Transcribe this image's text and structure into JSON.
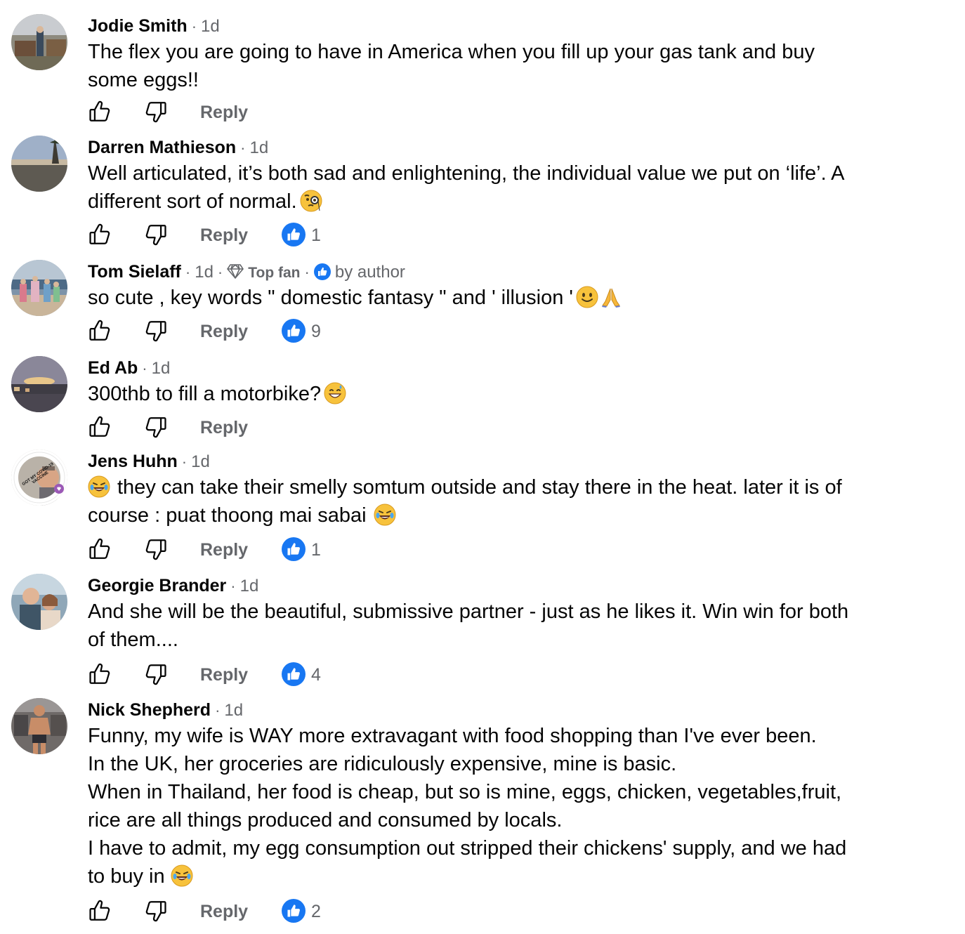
{
  "comments": [
    {
      "author": "Jodie Smith",
      "time": "1d",
      "lines": [
        "The flex you are going to have in America when you fill up your gas tank and buy",
        "some eggs!!"
      ],
      "reply_label": "Reply",
      "reaction_count": ""
    },
    {
      "author": "Darren Mathieson",
      "time": "1d",
      "lines": [
        "Well articulated, it’s both sad and enlightening, the individual value we put on ‘life’. A",
        "different sort of normal."
      ],
      "reply_label": "Reply",
      "reaction_count": "1"
    },
    {
      "author": "Tom Sielaff",
      "time": "1d",
      "badge": "Top fan",
      "author_tag": "by author",
      "lines": [
        "so cute , key words \" domestic fantasy \" and ' illusion '"
      ],
      "reply_label": "Reply",
      "reaction_count": "9"
    },
    {
      "author": "Ed Ab",
      "time": "1d",
      "lines": [
        "300thb to fill a motorbike?"
      ],
      "reply_label": "Reply",
      "reaction_count": ""
    },
    {
      "author": "Jens Huhn",
      "time": "1d",
      "lines": [
        "they can take their smelly somtum outside and stay there in the heat. later it is of",
        "course : puat thoong mai sabai"
      ],
      "reply_label": "Reply",
      "reaction_count": "1"
    },
    {
      "author": "Georgie Brander",
      "time": "1d",
      "lines": [
        "And she will be the beautiful, submissive partner - just as he likes it. Win win for both",
        "of them...."
      ],
      "reply_label": "Reply",
      "reaction_count": "4"
    },
    {
      "author": "Nick Shepherd",
      "time": "1d",
      "lines": [
        "Funny, my wife is WAY more extravagant with food shopping than I've ever been.",
        "In the UK, her groceries are ridiculously expensive, mine is basic.",
        "When in Thailand, her food is cheap, but so is mine, eggs, chicken, vegetables,fruit,",
        "rice are all things produced and consumed by locals.",
        "I have to admit, my egg consumption out stripped their chickens' supply, and we had",
        "to buy in"
      ],
      "reply_label": "Reply",
      "reaction_count": "2"
    }
  ],
  "avatar_text": "GOT MY COVID-19 VACCINE",
  "icons": {
    "like": "thumbs-up-outline-icon",
    "dislike": "thumbs-down-outline-icon",
    "reaction": "like-reaction-icon",
    "top_fan": "diamond-icon",
    "author_badge": "like-badge-icon"
  },
  "colors": {
    "accent": "#1877f2",
    "secondary_text": "#65676b",
    "primary_text": "#050505"
  }
}
